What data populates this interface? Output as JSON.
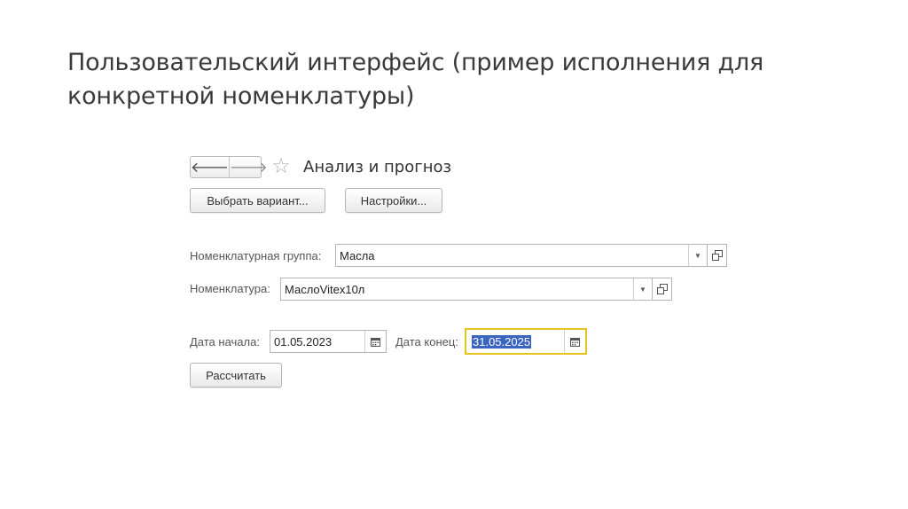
{
  "slide": {
    "title_line1": "Пользовательский интерфейс (пример исполнения для",
    "title_line2": "конкретной номенклатуры)"
  },
  "toolbar": {
    "back_icon": "arrow-left",
    "forward_icon": "arrow-right",
    "favorite_icon": "star",
    "form_title": "Анализ и прогноз"
  },
  "buttons": {
    "choose_variant": "Выбрать вариант...",
    "settings": "Настройки...",
    "calculate": "Рассчитать"
  },
  "fields": {
    "nomenclature_group": {
      "label": "Номенклатурная группа:",
      "value": "Масла"
    },
    "nomenclature": {
      "label": "Номенклатура:",
      "value": "МаслоVitex10л"
    },
    "date_start": {
      "label": "Дата начала:",
      "value": "01.05.2023"
    },
    "date_end": {
      "label": "Дата конец:",
      "value": "31.05.2025"
    }
  },
  "colors": {
    "focus_border": "#e6c31e",
    "selection": "#3b64c0"
  }
}
